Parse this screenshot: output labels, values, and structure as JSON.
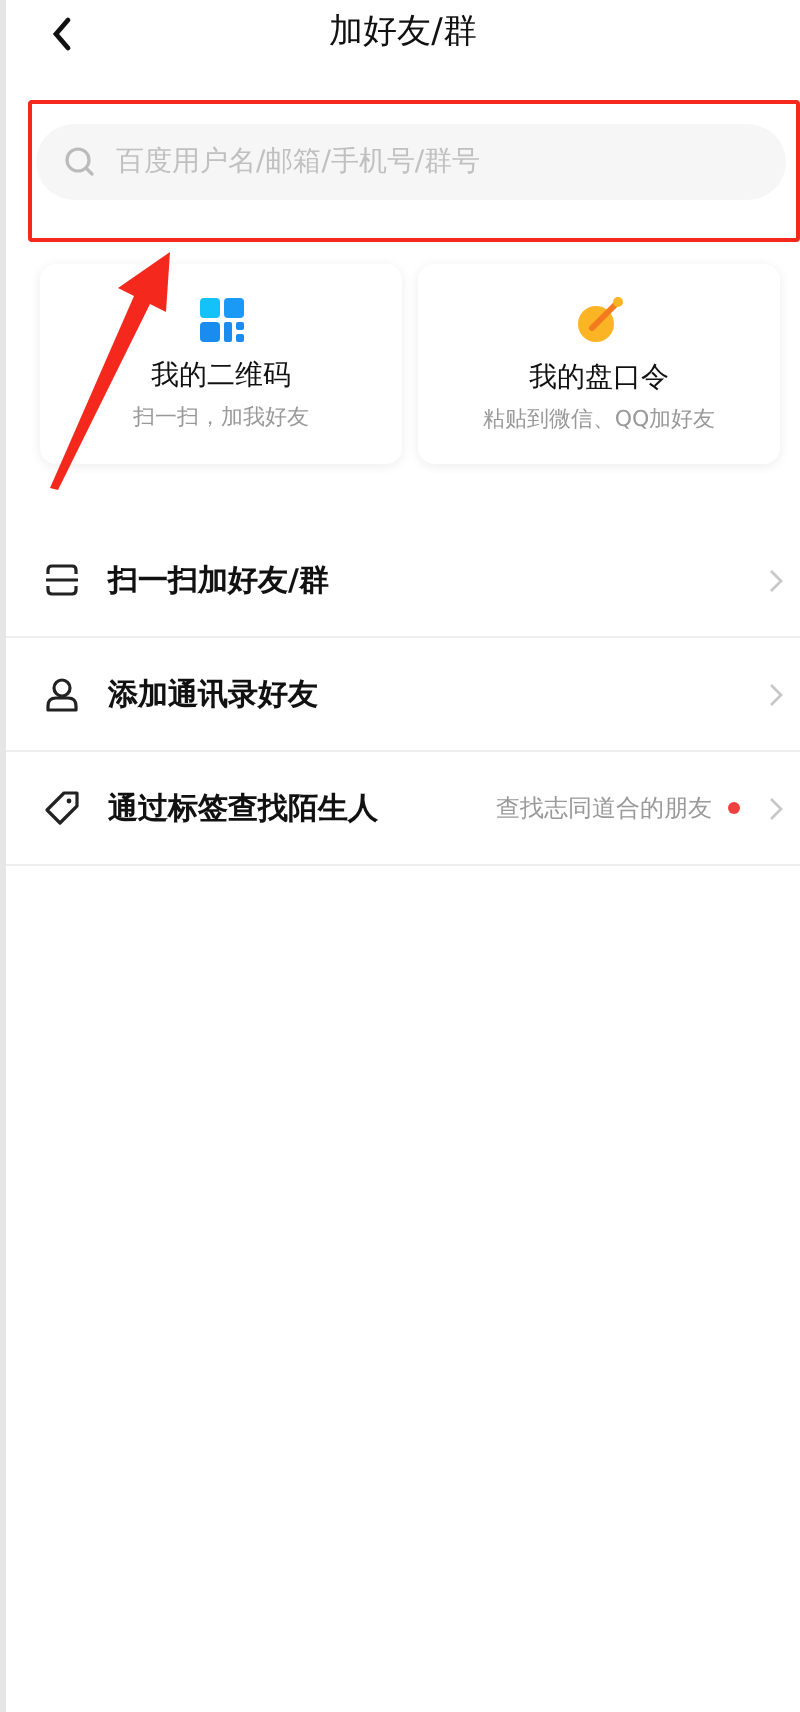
{
  "header": {
    "title": "加好友/群"
  },
  "search": {
    "placeholder": "百度用户名/邮箱/手机号/群号",
    "highlighted": true
  },
  "cards": [
    {
      "kind": "qrcode",
      "title": "我的二维码",
      "subtitle": "扫一扫，加我好友"
    },
    {
      "kind": "key",
      "title": "我的盘口令",
      "subtitle": "粘贴到微信、QQ加好友"
    }
  ],
  "items": [
    {
      "kind": "scan",
      "label": "扫一扫加好友/群",
      "dot": false
    },
    {
      "kind": "contact",
      "label": "添加通讯录好友",
      "dot": false
    },
    {
      "kind": "tag",
      "label": "通过标签查找陌生人",
      "hint": "查找志同道合的朋友",
      "dot": true
    }
  ]
}
